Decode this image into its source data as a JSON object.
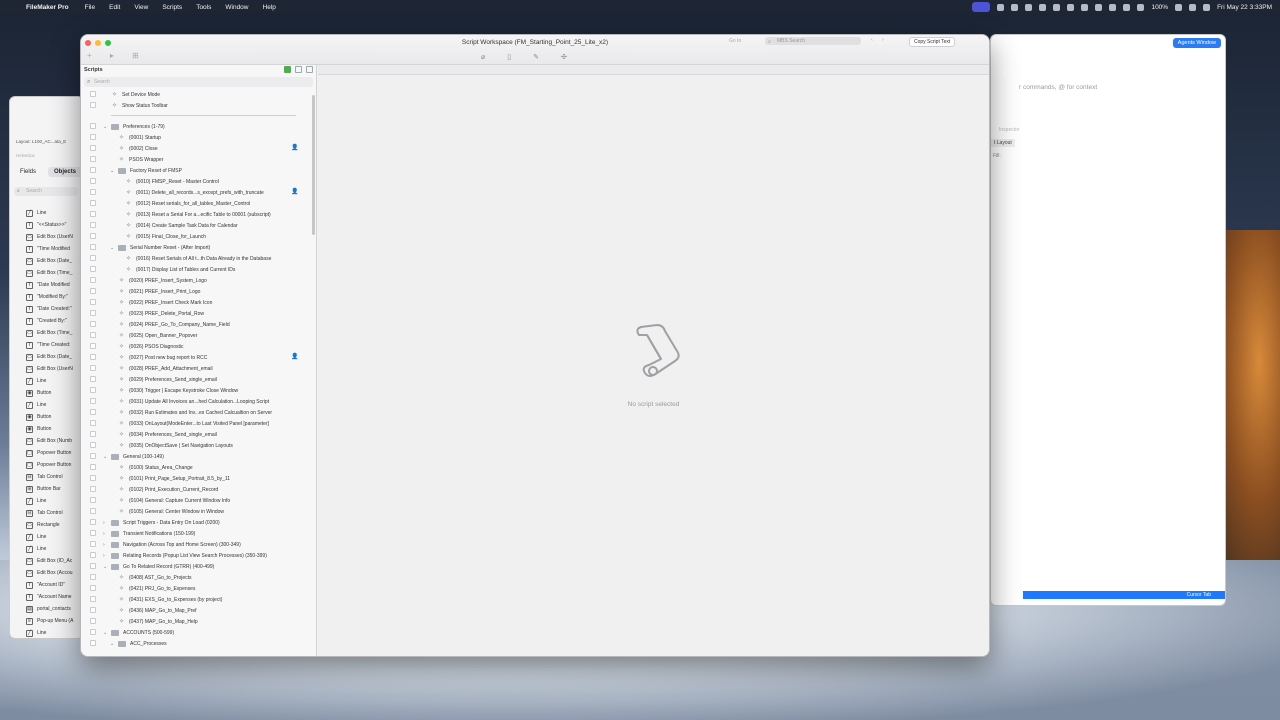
{
  "menubar": {
    "app": "FileMaker Pro",
    "items": [
      "File",
      "Edit",
      "View",
      "Scripts",
      "Tools",
      "Window",
      "Help"
    ],
    "battery": "100%",
    "datetime": "Fri May 22  3:33PM"
  },
  "window": {
    "title": "Script Workspace (FM_Starting_Point_25_Lite_x2)",
    "goto_label": "Go to",
    "search_placeholder": "MBS Search",
    "copy_button": "Copy Script Text"
  },
  "scripts_pane": {
    "title": "Scripts",
    "search_placeholder": "Search",
    "items": [
      {
        "label": "Set Device Mode",
        "type": "script",
        "level": 0
      },
      {
        "label": "Show Status Toolbar",
        "type": "script",
        "level": 0
      },
      {
        "type": "separator"
      },
      {
        "label": "Preferences (1-79)",
        "type": "folder",
        "level": 0,
        "expanded": true
      },
      {
        "label": "(0001) Startup",
        "type": "script",
        "level": 1
      },
      {
        "label": "(0002) Close",
        "type": "script",
        "level": 1,
        "account": true
      },
      {
        "label": "PSOS Wrapper",
        "type": "script",
        "level": 1
      },
      {
        "label": "Factory Reset of FMSP",
        "type": "folder",
        "level": 1,
        "expanded": true
      },
      {
        "label": "(0010) FMSP_Reset - Master Control",
        "type": "script",
        "level": 2
      },
      {
        "label": "(0011) Delete_all_records...s_except_prefs_with_truncate",
        "type": "script",
        "level": 2,
        "account": true
      },
      {
        "label": "(0012) Reset serials_for_all_tables_Master_Control",
        "type": "script",
        "level": 2
      },
      {
        "label": "(0013) Reset a Serial For a...ecific Table to 00001 (subscript)",
        "type": "script",
        "level": 2
      },
      {
        "label": "(0014) Create Sample Task Data for Calendar",
        "type": "script",
        "level": 2
      },
      {
        "label": "(0015) Final_Close_for_Launch",
        "type": "script",
        "level": 2
      },
      {
        "label": "Serial Number Reset - (After Import)",
        "type": "folder",
        "level": 1,
        "expanded": true
      },
      {
        "label": "(0016) Reset Serials of All t...th Data Already in the Database",
        "type": "script",
        "level": 2
      },
      {
        "label": "(0017) Display List of Tables and Current IDs",
        "type": "script",
        "level": 2
      },
      {
        "label": "(0020) PREF_Insert_System_Logo",
        "type": "script",
        "level": 1
      },
      {
        "label": "(0021) PREF_Insert_Print_Logo",
        "type": "script",
        "level": 1
      },
      {
        "label": "(0022) PREF_Insert Check Mark Icon",
        "type": "script",
        "level": 1
      },
      {
        "label": "(0023) PREF_Delete_Portal_Row",
        "type": "script",
        "level": 1
      },
      {
        "label": "(0024) PREF_Go_To_Company_Name_Field",
        "type": "script",
        "level": 1
      },
      {
        "label": "(0025) Open_Banner_Popover",
        "type": "script",
        "level": 1
      },
      {
        "label": "(0026) PSOS Diagnostic",
        "type": "script",
        "level": 1
      },
      {
        "label": "(0027) Post new bug report to RCC",
        "type": "script",
        "level": 1,
        "account": true
      },
      {
        "label": "(0028) PREF_Add_Attachment_email",
        "type": "script",
        "level": 1
      },
      {
        "label": "(0029) Preferences_Send_single_email",
        "type": "script",
        "level": 1
      },
      {
        "label": "(0030) Trigger | Escape Keystroke Close Window",
        "type": "script",
        "level": 1
      },
      {
        "label": "(0031) Update All Invoices an...hed Calculation...Looping Script",
        "type": "script",
        "level": 1
      },
      {
        "label": "(0032) Run Estimates and Inv...es Cached Calcualtion on Server",
        "type": "script",
        "level": 1
      },
      {
        "label": "(0033) OnLayout(ModeEnter...to Last Visited Panel [parameter]",
        "type": "script",
        "level": 1
      },
      {
        "label": "(0034) Preferences_Send_single_email",
        "type": "script",
        "level": 1
      },
      {
        "label": "(0035) OnObjectSave | Set Navigation Layouts",
        "type": "script",
        "level": 1
      },
      {
        "label": "General (100-149)",
        "type": "folder",
        "level": 0,
        "expanded": true
      },
      {
        "label": "(0100) Status_Area_Change",
        "type": "script",
        "level": 1
      },
      {
        "label": "(0101) Print_Page_Setup_Portrait_8.5_by_11",
        "type": "script",
        "level": 1
      },
      {
        "label": "(0102) Print_Execution_Current_Record",
        "type": "script",
        "level": 1
      },
      {
        "label": "(0104) General: Capture Current Window Info",
        "type": "script",
        "level": 1
      },
      {
        "label": "(0105) General: Center Window in Window",
        "type": "script",
        "level": 1
      },
      {
        "label": "Script Triggers - Data Entry On Load (0200)",
        "type": "folder",
        "level": 0,
        "expanded": false
      },
      {
        "label": "Transient Notifications (150-199)",
        "type": "folder",
        "level": 0,
        "expanded": false
      },
      {
        "label": "Navigation (Across Top and Home Screen) (300-349)",
        "type": "folder",
        "level": 0,
        "expanded": false
      },
      {
        "label": "Relating Records (Popup List View Search Processes) (350-399)",
        "type": "folder",
        "level": 0,
        "expanded": false
      },
      {
        "label": "Go To Related Record (GTRR) (400-499)",
        "type": "folder",
        "level": 0,
        "expanded": true
      },
      {
        "label": "(0408) AST_Go_to_Projects",
        "type": "script",
        "level": 1
      },
      {
        "label": "(0421) PRJ_Go_to_Expenses",
        "type": "script",
        "level": 1
      },
      {
        "label": "(0431) EXS_Go_to_Expenses (by project)",
        "type": "script",
        "level": 1
      },
      {
        "label": "(0436) MAP_Go_to_Map_Pref",
        "type": "script",
        "level": 1
      },
      {
        "label": "(0437) MAP_Go_to_Map_Help",
        "type": "script",
        "level": 1
      },
      {
        "label": "ACCOUNTS (500-599)",
        "type": "folder",
        "level": 0,
        "expanded": true
      },
      {
        "label": "ACC_Processes",
        "type": "folder",
        "level": 1,
        "expanded": true
      }
    ]
  },
  "content": {
    "empty_message": "No script selected"
  },
  "layout_objects_window": {
    "tabs": [
      "Fields",
      "Objects"
    ],
    "layout_label": "Layout:",
    "layout_value": "L100_AC...ata_E",
    "font": "Helvetica",
    "objects_label": "Objects",
    "search_placeholder": "Search",
    "items": [
      {
        "label": "Line",
        "icon": "line-icon"
      },
      {
        "label": "\"<<Status>>\"",
        "icon": "text-icon"
      },
      {
        "label": "Edit Box (UserN",
        "icon": "editbox-icon"
      },
      {
        "label": "\"Time Modified",
        "icon": "text-icon"
      },
      {
        "label": "Edit Box (Date_",
        "icon": "editbox-icon"
      },
      {
        "label": "Edit Box (Time_",
        "icon": "editbox-icon"
      },
      {
        "label": "\"Date Modified",
        "icon": "text-icon"
      },
      {
        "label": "\"Modified By:\"",
        "icon": "text-icon"
      },
      {
        "label": "\"Date Created:\"",
        "icon": "text-icon"
      },
      {
        "label": "\"Created By:\"",
        "icon": "text-icon"
      },
      {
        "label": "Edit Box (Time_",
        "icon": "editbox-icon"
      },
      {
        "label": "\"Time Created:",
        "icon": "text-icon"
      },
      {
        "label": "Edit Box (Date_",
        "icon": "editbox-icon"
      },
      {
        "label": "Edit Box (UserN",
        "icon": "editbox-icon"
      },
      {
        "label": "Line",
        "icon": "line-icon"
      },
      {
        "label": "Button",
        "icon": "button-icon"
      },
      {
        "label": "Line",
        "icon": "line-icon"
      },
      {
        "label": "Button",
        "icon": "button-icon"
      },
      {
        "label": "Button",
        "icon": "button-icon"
      },
      {
        "label": "Edit Box (Numb",
        "icon": "editbox-icon"
      },
      {
        "label": "Popover Button",
        "icon": "popover-icon"
      },
      {
        "label": "Popover Button",
        "icon": "popover-icon"
      },
      {
        "label": "Tab Control",
        "icon": "tab-icon"
      },
      {
        "label": "Button Bar",
        "icon": "buttonbar-icon"
      },
      {
        "label": "Line",
        "icon": "line-icon"
      },
      {
        "label": "Tab Control",
        "icon": "tab-icon"
      },
      {
        "label": "Rectangle",
        "icon": "rect-icon"
      },
      {
        "label": "Line",
        "icon": "line-icon"
      },
      {
        "label": "Line",
        "icon": "line-icon"
      },
      {
        "label": "Edit Box (ID_Ac",
        "icon": "editbox-icon"
      },
      {
        "label": "Edit Box (Accou",
        "icon": "editbox-icon"
      },
      {
        "label": "\"Account ID\"",
        "icon": "text-icon"
      },
      {
        "label": "\"Account Name",
        "icon": "text-icon"
      },
      {
        "label": "portal_contacts",
        "icon": "portal-icon"
      },
      {
        "label": "Pop-up Menu (A",
        "icon": "popup-icon"
      },
      {
        "label": "Line",
        "icon": "line-icon"
      }
    ]
  },
  "agent_window": {
    "button": "Agents Window",
    "prompt_placeholder": "r commands, @ for context",
    "inspector_label": "Inspector",
    "layout_button": "t Layout",
    "fill_label": "Fill:",
    "footer_label": "Cursor Tab"
  },
  "colors": {
    "accent": "#2a7bf5",
    "traffic_red": "#ff5f57",
    "traffic_yellow": "#febc2e",
    "traffic_green": "#28c840"
  }
}
